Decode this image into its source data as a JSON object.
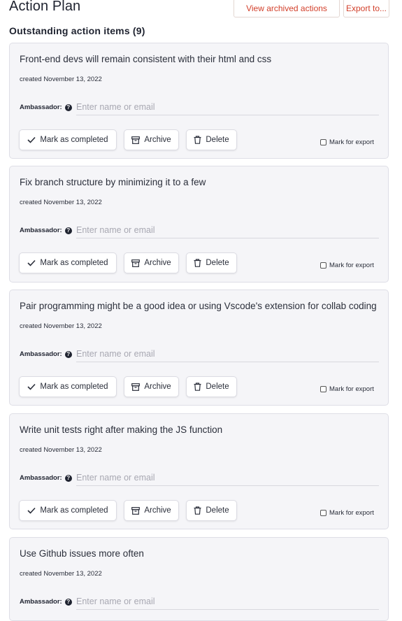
{
  "header": {
    "title": "Action Plan",
    "view_archived_label": "View archived actions",
    "export_label": "Export to..."
  },
  "section": {
    "title": "Outstanding action items (9)"
  },
  "common": {
    "ambassador_label": "Ambassador:",
    "ambassador_placeholder": "Enter name or email",
    "mark_completed_label": "Mark as completed",
    "archive_label": "Archive",
    "delete_label": "Delete",
    "mark_export_label": "Mark for export"
  },
  "items": [
    {
      "text": "Front-end devs will remain consistent with their html and css",
      "created": "created November 13, 2022"
    },
    {
      "text": "Fix branch structure by minimizing it to a few",
      "created": "created November 13, 2022"
    },
    {
      "text": "Pair programming might be a good idea or using Vscode's extension for collab coding",
      "created": "created November 13, 2022"
    },
    {
      "text": "Write unit tests right after making the JS function",
      "created": "created November 13, 2022"
    },
    {
      "text": "Use Github issues more often",
      "created": "created November 13, 2022"
    }
  ],
  "colors": {
    "accent": "#d23f2a",
    "card_bg": "#f5f5f8",
    "text": "#1f2330"
  }
}
